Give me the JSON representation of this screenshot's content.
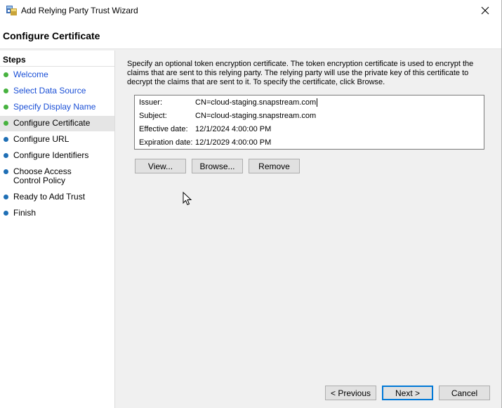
{
  "window": {
    "title": "Add Relying Party Trust Wizard"
  },
  "header": {
    "title": "Configure Certificate"
  },
  "sidebar": {
    "title": "Steps",
    "items": [
      {
        "label": "Welcome",
        "state": "done"
      },
      {
        "label": "Select Data Source",
        "state": "done"
      },
      {
        "label": "Specify Display Name",
        "state": "done"
      },
      {
        "label": "Configure Certificate",
        "state": "current"
      },
      {
        "label": "Configure URL",
        "state": "pending"
      },
      {
        "label": "Configure Identifiers",
        "state": "pending"
      },
      {
        "label": "Choose Access Control Policy",
        "state": "pending"
      },
      {
        "label": "Ready to Add Trust",
        "state": "pending"
      },
      {
        "label": "Finish",
        "state": "pending"
      }
    ]
  },
  "main": {
    "description": "Specify an optional token encryption certificate.  The token encryption certificate is used to encrypt the claims that are sent to this relying party.  The relying party will use the private key of this certificate to decrypt the claims that are sent to it.  To specify the certificate, click Browse.",
    "certificate": {
      "issuer_label": "Issuer:",
      "issuer": "CN=cloud-staging.snapstream.com",
      "subject_label": "Subject:",
      "subject": "CN=cloud-staging.snapstream.com",
      "effective_label": "Effective date:",
      "effective": "12/1/2024 4:00:00 PM",
      "expiration_label": "Expiration date:",
      "expiration": "12/1/2029 4:00:00 PM"
    },
    "buttons": {
      "view": "View...",
      "browse": "Browse...",
      "remove": "Remove"
    }
  },
  "footer": {
    "previous": "< Previous",
    "next": "Next >",
    "cancel": "Cancel"
  },
  "colors": {
    "done_bullet": "#47b23f",
    "pending_bullet": "#1f6fb5",
    "link": "#1a4fd6",
    "accent": "#0078d7"
  }
}
